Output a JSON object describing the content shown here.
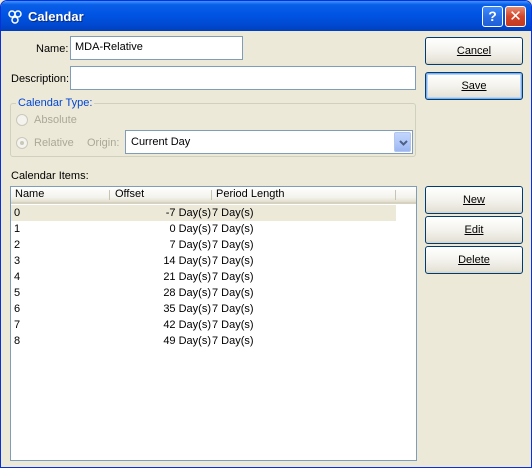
{
  "window": {
    "title": "Calendar"
  },
  "form": {
    "name_label": "Name:",
    "name_value": "MDA-Relative",
    "description_label": "Description:",
    "description_value": ""
  },
  "buttons": {
    "cancel": "Cancel",
    "save": "Save",
    "new": "New",
    "edit": "Edit",
    "delete": "Delete"
  },
  "calendar_type": {
    "title": "Calendar Type:",
    "absolute_label": "Absolute",
    "relative_label": "Relative",
    "selected": "Relative",
    "origin_label": "Origin:",
    "origin_value": "Current Day"
  },
  "items": {
    "label": "Calendar Items:",
    "columns": [
      "Name",
      "Offset",
      "Period Length"
    ],
    "selected_index": 0,
    "rows": [
      {
        "name": "0",
        "offset": "-7 Day(s)",
        "period": "7 Day(s)"
      },
      {
        "name": "1",
        "offset": "0 Day(s)",
        "period": "7 Day(s)"
      },
      {
        "name": "2",
        "offset": "7 Day(s)",
        "period": "7 Day(s)"
      },
      {
        "name": "3",
        "offset": "14 Day(s)",
        "period": "7 Day(s)"
      },
      {
        "name": "4",
        "offset": "21 Day(s)",
        "period": "7 Day(s)"
      },
      {
        "name": "5",
        "offset": "28 Day(s)",
        "period": "7 Day(s)"
      },
      {
        "name": "6",
        "offset": "35 Day(s)",
        "period": "7 Day(s)"
      },
      {
        "name": "7",
        "offset": "42 Day(s)",
        "period": "7 Day(s)"
      },
      {
        "name": "8",
        "offset": "49 Day(s)",
        "period": "7 Day(s)"
      }
    ]
  },
  "icons": {
    "app": "calendar-app-icon",
    "help": "help-icon",
    "close": "close-icon",
    "dropdown": "chevron-down-icon"
  },
  "colors": {
    "titlebar": "#0054e3",
    "accent_text": "#0046d5",
    "selected_row": "#ece9d8"
  }
}
